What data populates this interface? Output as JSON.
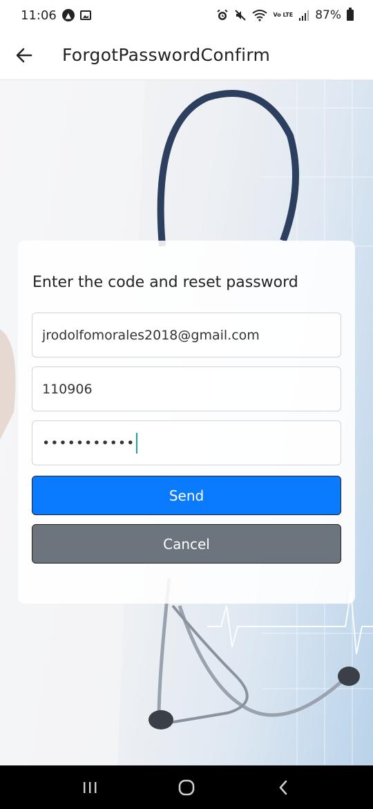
{
  "status_bar": {
    "time": "11:06",
    "battery_percent": "87%",
    "icons": [
      "navigation-app-icon",
      "gallery-notification-icon",
      "alarm-icon",
      "mute-icon",
      "wifi-icon",
      "volte-lte-icon",
      "signal-icon",
      "battery-icon"
    ],
    "volte_label": "Vo LTE"
  },
  "app_bar": {
    "title": "ForgotPasswordConfirm",
    "back_icon": "arrow-left-icon"
  },
  "form": {
    "heading": "Enter the code and reset password",
    "email_value": "jrodolfomorales2018@gmail.com",
    "code_value": "110906",
    "password_masked": "•••••••••••",
    "send_label": "Send",
    "cancel_label": "Cancel"
  },
  "colors": {
    "send_button": "#0a7bff",
    "cancel_button": "#6c757d",
    "caret": "#1aa5a5"
  },
  "nav_bar": {
    "icons": [
      "recent-apps-icon",
      "home-icon",
      "back-icon"
    ]
  }
}
